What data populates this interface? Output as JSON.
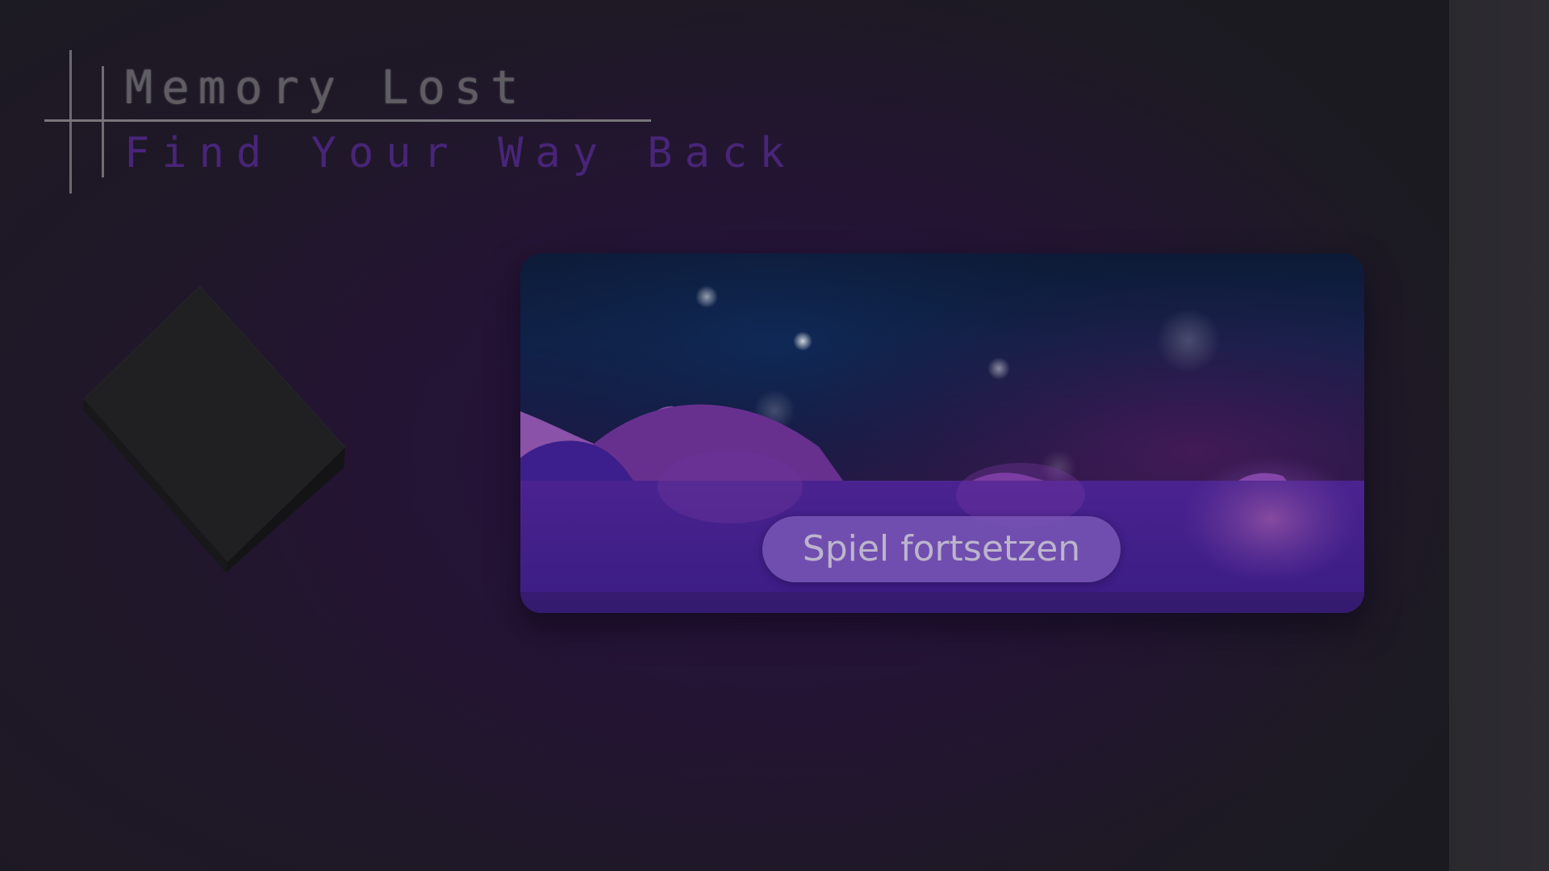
{
  "game": {
    "title": "Memory Lost",
    "subtitle": "Find Your Way Back",
    "continue_label": "Spiel fortsetzen"
  },
  "colors": {
    "title": "#5f5d63",
    "subtitle": "#482578",
    "button_bg": "#7452b2",
    "button_text": "#bdb4cc",
    "background": "#1c1a21"
  },
  "icons": {
    "cube": "dark-cube-icon"
  }
}
